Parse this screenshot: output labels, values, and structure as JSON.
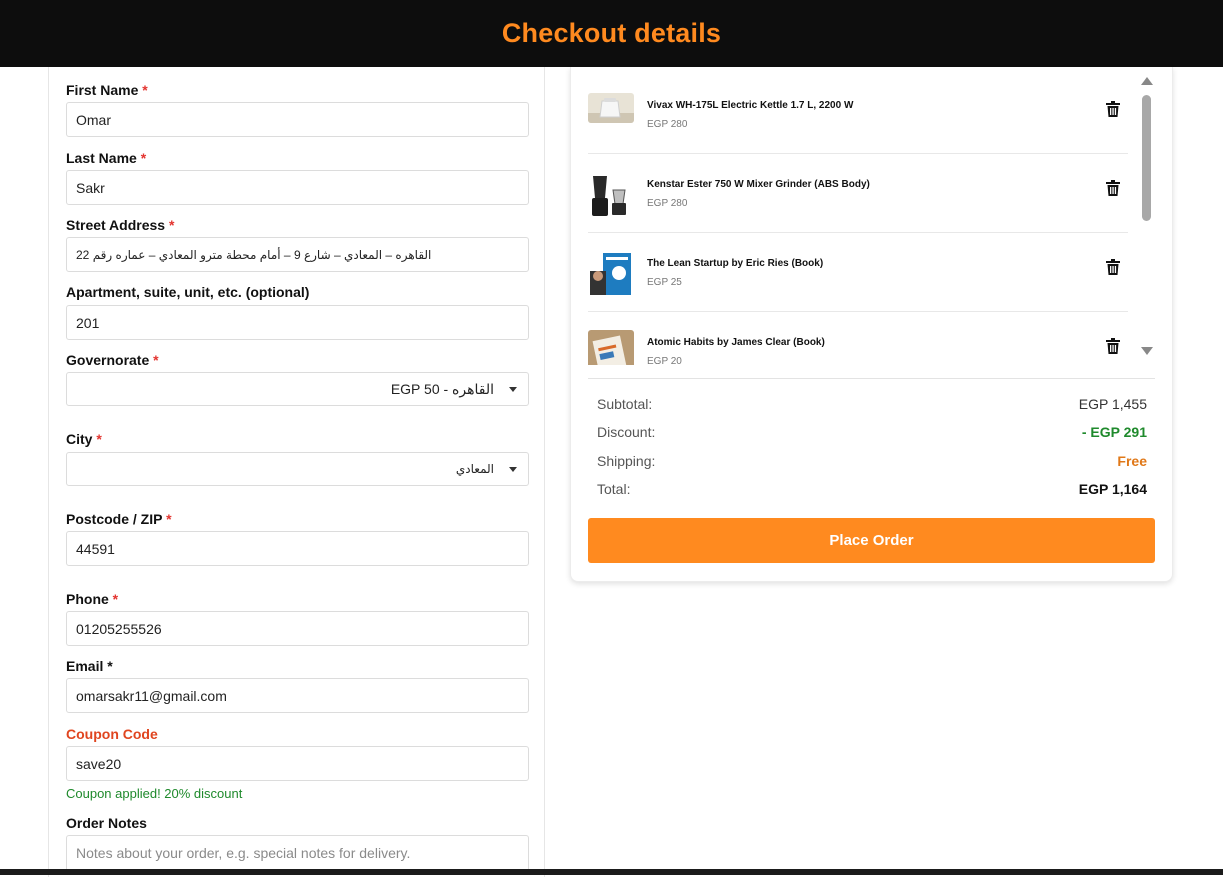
{
  "header": {
    "title": "Checkout details"
  },
  "form": {
    "first_name": {
      "label": "First Name",
      "required": "*",
      "value": "Omar"
    },
    "last_name": {
      "label": "Last Name",
      "required": "*",
      "value": "Sakr"
    },
    "street": {
      "label": "Street Address",
      "required": "*",
      "value": "القاهره – المعادي – شارع 9 – أمام محطة مترو المعادي – عماره رقم 22"
    },
    "apartment": {
      "label": "Apartment, suite, unit, etc. (optional)",
      "value": "201"
    },
    "governorate": {
      "label": "Governorate",
      "required": "*",
      "value": "القاهره - EGP 50"
    },
    "city": {
      "label": "City",
      "required": "*",
      "value": "المعادي"
    },
    "postcode": {
      "label": "Postcode / ZIP",
      "required": "*",
      "value": "44591"
    },
    "phone": {
      "label": "Phone",
      "required": "*",
      "value": "01205255526"
    },
    "email": {
      "label": "Email *",
      "value": "omarsakr11@gmail.com"
    },
    "coupon": {
      "label": "Coupon Code",
      "value": "save20",
      "message": "Coupon applied! 20% discount"
    },
    "notes": {
      "label": "Order Notes",
      "placeholder": "Notes about your order, e.g. special notes for delivery."
    }
  },
  "cart": {
    "items": [
      {
        "name": "Vivax WH-175L Electric Kettle 1.7 L, 2200 W",
        "price": "EGP 280",
        "icon": "kettle-thumbnail"
      },
      {
        "name": "Kenstar Ester 750 W Mixer Grinder (ABS Body)",
        "price": "EGP 280",
        "icon": "mixer-thumbnail"
      },
      {
        "name": "The Lean Startup by Eric Ries (Book)",
        "price": "EGP 25",
        "icon": "book-thumbnail"
      },
      {
        "name": "Atomic Habits by James Clear (Book)",
        "price": "EGP 20",
        "icon": "book-thumbnail"
      }
    ],
    "totals": {
      "subtotal_label": "Subtotal:",
      "subtotal": "EGP 1,455",
      "discount_label": "Discount:",
      "discount": "- EGP 291",
      "shipping_label": "Shipping:",
      "shipping": "Free",
      "total_label": "Total:",
      "total": "EGP 1,164"
    },
    "place_order": "Place Order"
  },
  "colors": {
    "accent": "#ff8a1f",
    "header_bg": "#0d0d0d",
    "success": "#1f8a2c",
    "required": "#e3342f"
  }
}
